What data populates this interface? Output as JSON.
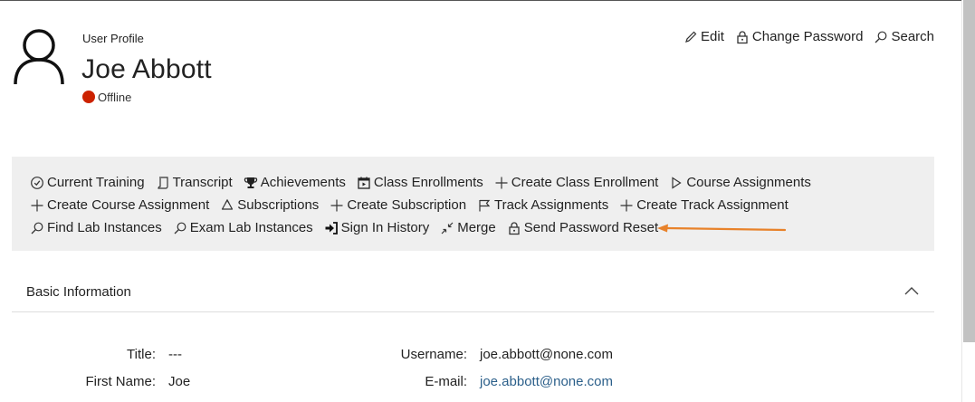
{
  "profile": {
    "header_label": "User Profile",
    "name": "Joe Abbott",
    "status": "Offline",
    "status_color": "#cc2200"
  },
  "header_actions": [
    {
      "label": "Edit",
      "icon": "pencil-icon"
    },
    {
      "label": "Change Password",
      "icon": "lock-icon"
    },
    {
      "label": "Search",
      "icon": "search-icon"
    }
  ],
  "actions": {
    "row1": [
      {
        "label": "Current Training",
        "icon": "clock-check-icon"
      },
      {
        "label": "Transcript",
        "icon": "scroll-icon"
      },
      {
        "label": "Achievements",
        "icon": "trophy-icon"
      },
      {
        "label": "Class Enrollments",
        "icon": "calendar-icon"
      },
      {
        "label": "Create Class Enrollment",
        "icon": "plus-icon"
      },
      {
        "label": "Course Assignments",
        "icon": "play-icon"
      }
    ],
    "row2": [
      {
        "label": "Create Course Assignment",
        "icon": "plus-icon"
      },
      {
        "label": "Subscriptions",
        "icon": "recycle-icon"
      },
      {
        "label": "Create Subscription",
        "icon": "plus-icon"
      },
      {
        "label": "Track Assignments",
        "icon": "flag-icon"
      },
      {
        "label": "Create Track Assignment",
        "icon": "plus-icon"
      }
    ],
    "row3": [
      {
        "label": "Find Lab Instances",
        "icon": "search-icon"
      },
      {
        "label": "Exam Lab Instances",
        "icon": "search-icon"
      },
      {
        "label": "Sign In History",
        "icon": "sign-in-icon"
      },
      {
        "label": "Merge",
        "icon": "merge-icon"
      },
      {
        "label": "Send Password Reset",
        "icon": "lock-icon"
      }
    ]
  },
  "annotation_arrow_color": "#e8822a",
  "basic_info": {
    "title": "Basic Information",
    "fields": {
      "title_label": "Title:",
      "title_value": "---",
      "first_name_label": "First Name:",
      "first_name_value": "Joe",
      "username_label": "Username:",
      "username_value": "joe.abbott@none.com",
      "email_label": "E-mail:",
      "email_value": "joe.abbott@none.com"
    }
  }
}
